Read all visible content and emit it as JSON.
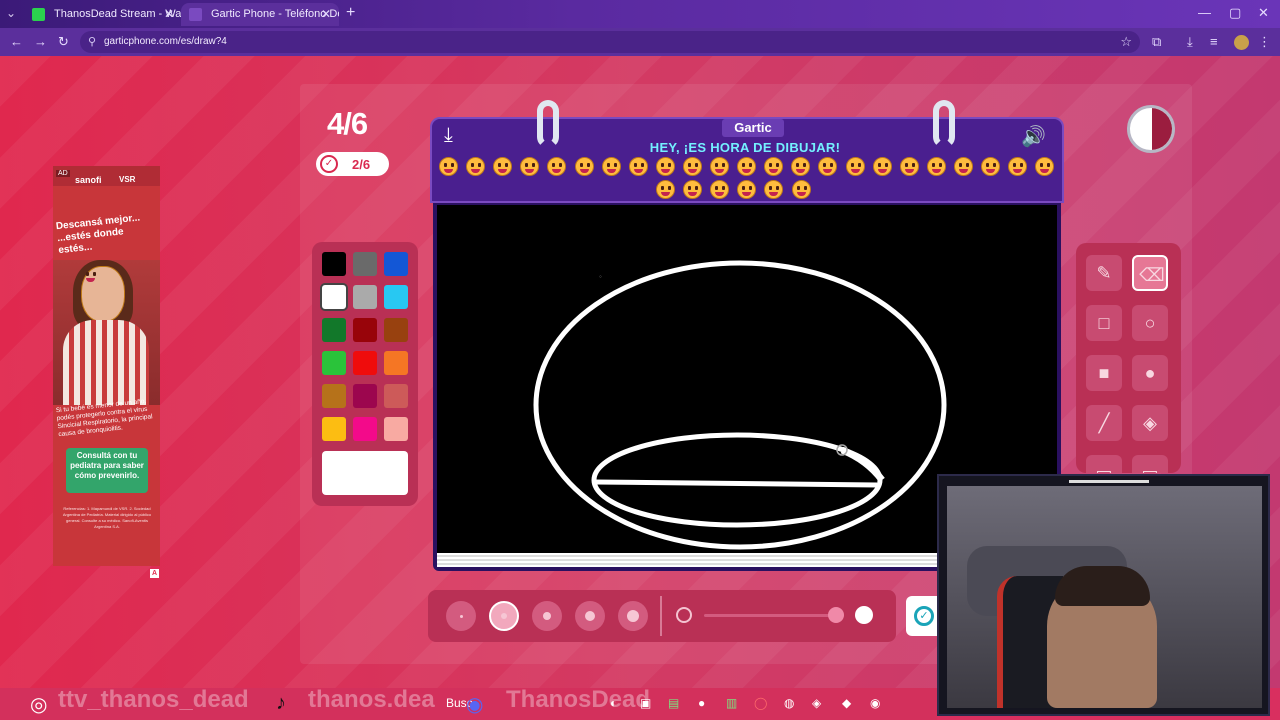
{
  "browser": {
    "tabs": [
      {
        "title": "ThanosDead Stream - Watch Li",
        "favicon_color": "#2bd14e",
        "active": false
      },
      {
        "title": "Gartic Phone - Teléfono Descor",
        "favicon_color": "#7a4ac0",
        "active": true
      }
    ],
    "url": "garticphone.com/es/draw?4",
    "icons": {
      "back": "arrow-left-icon",
      "forward": "arrow-right-icon",
      "reload": "reload-icon",
      "star": "star-icon"
    }
  },
  "ad": {
    "label": "AD",
    "brand": "sanofi",
    "vsr": "VSR",
    "headline": "Descansá mejor... ...estés donde estés...",
    "small_text": "Si tu bebé es menor de un año, podés protegerlo contra el virus Sincicial Respiratorio, la principal causa de bronquiolitis.",
    "cta": "Consultá con tu pediatra para saber cómo prevenirlo.",
    "legal": "Referencias: 1. Mapamundi de VSR. 2. Sociedad Argentina de Pediatría. Material dirigido al público general. Consulte a su médico. Sanofi-Aventis Argentina S.A.",
    "badge": "A"
  },
  "game": {
    "round": "4/6",
    "submitted": "2/6",
    "logo": "Gartic",
    "heading": "HEY, ¡ES HORA DE DIBUJAR!",
    "face_count": 29
  },
  "palette": {
    "colors": [
      "#000000",
      "#6a6a6a",
      "#1357d6",
      "#ffffff",
      "#aaaaaa",
      "#28c8f2",
      "#12782a",
      "#98040a",
      "#98410f",
      "#2ac33a",
      "#ef0c0c",
      "#f57624",
      "#b6721a",
      "#9c064e",
      "#cd5a59",
      "#fcbd12",
      "#f30a8a",
      "#f8aaa2"
    ],
    "selected_index": 3,
    "current_color": "#ffffff"
  },
  "tools": [
    "pencil-icon",
    "eraser-icon",
    "rectangle-outline-icon",
    "ellipse-outline-icon",
    "rectangle-filled-icon",
    "ellipse-filled-icon",
    "line-icon",
    "fill-bucket-icon"
  ],
  "selected_tool_index": 1,
  "brush_sizes": 5,
  "selected_brush_index": 1,
  "overlay": {
    "twitch": "ttv_thanos_dead",
    "tiktok": "thanos.dea",
    "discord": "ThanosDead",
    "search": "Busc"
  }
}
